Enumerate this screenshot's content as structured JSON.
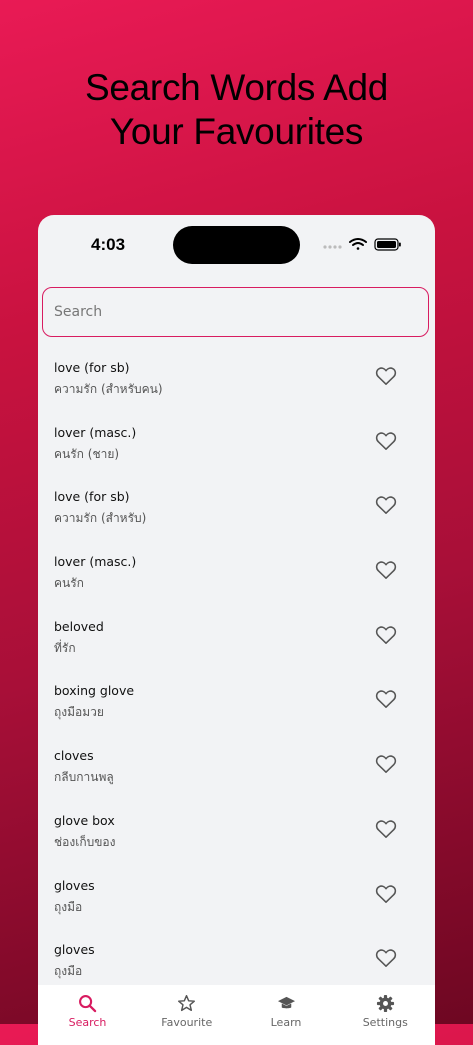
{
  "headline": {
    "line1": "Search Words Add",
    "line2": "Your Favourites"
  },
  "status_bar": {
    "time": "4:03"
  },
  "search": {
    "placeholder": "Search"
  },
  "words": [
    {
      "en": "love (for sb)",
      "th": "ความรัก (สำหรับคน)"
    },
    {
      "en": "lover (masc.)",
      "th": "คนรัก (ชาย)"
    },
    {
      "en": "love (for sb)",
      "th": "ความรัก (สำหรับ)"
    },
    {
      "en": "lover (masc.)",
      "th": "คนรัก"
    },
    {
      "en": "beloved",
      "th": "ที่รัก"
    },
    {
      "en": "boxing glove",
      "th": "ถุงมือมวย"
    },
    {
      "en": "cloves",
      "th": "กลีบกานพลู"
    },
    {
      "en": "glove box",
      "th": "ช่องเก็บของ"
    },
    {
      "en": "gloves",
      "th": "ถุงมือ"
    },
    {
      "en": "gloves",
      "th": "ถุงมือ"
    }
  ],
  "tabs": [
    {
      "label": "Search",
      "icon": "search-icon",
      "active": true
    },
    {
      "label": "Favourite",
      "icon": "star-icon",
      "active": false
    },
    {
      "label": "Learn",
      "icon": "graduation-cap-icon",
      "active": false
    },
    {
      "label": "Settings",
      "icon": "gear-icon",
      "active": false
    }
  ],
  "colors": {
    "accent": "#d81b60",
    "background": "#c8123f",
    "card": "#f2f3f5"
  }
}
